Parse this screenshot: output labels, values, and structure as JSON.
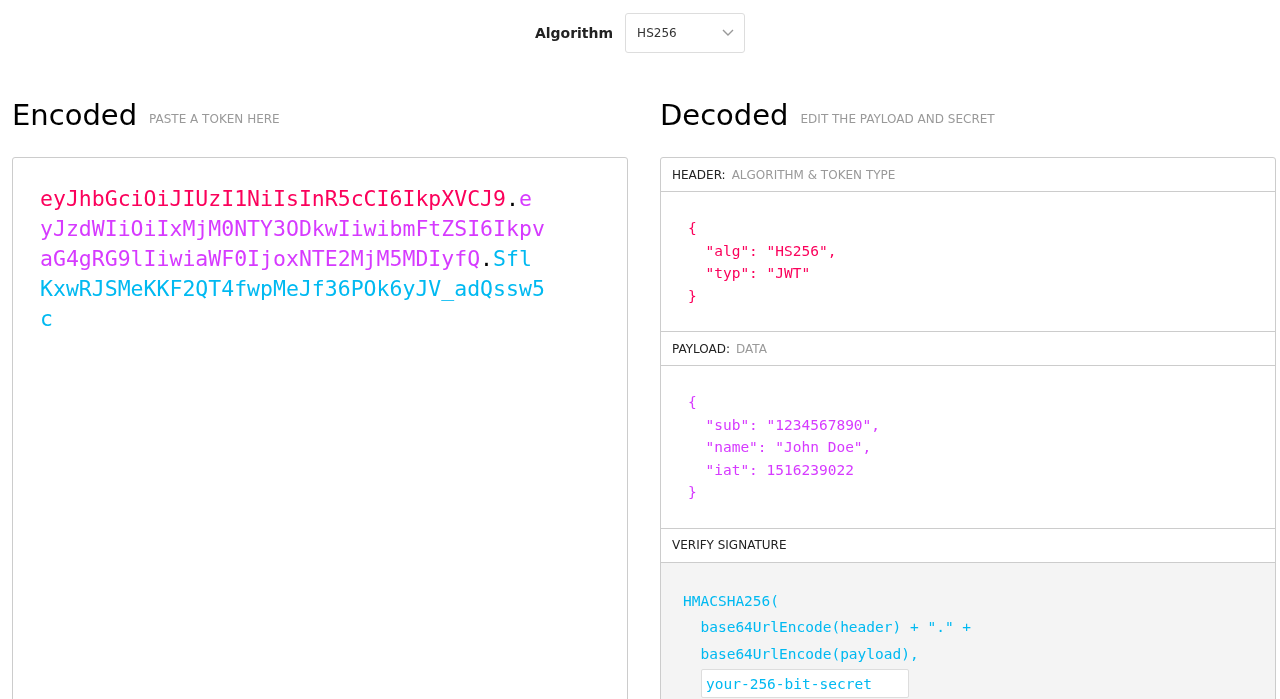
{
  "algorithm": {
    "label": "Algorithm",
    "value": "HS256"
  },
  "encoded": {
    "title": "Encoded",
    "subtitle": "PASTE A TOKEN HERE",
    "token": [
      {
        "text": "eyJhbGciOiJIUzI1NiIsInR5cCI6IkpXVCJ9",
        "color": "#fb015b"
      },
      {
        "text": ".",
        "color": "#000000"
      },
      {
        "text": "eyJzdWIiOiIxMjM0NTY3ODkwIiwibmFtZSI6IkpvaG4gRG9lIiwiaWF0IjoxNTE2MjM5MDIyfQ",
        "color": "#d63aff"
      },
      {
        "text": ".",
        "color": "#000000"
      },
      {
        "text": "SflKxwRJSMeKKF2QT4fwpMeJf36POk6yJV_adQssw5c",
        "color": "#00b9f1"
      }
    ]
  },
  "decoded": {
    "title": "Decoded",
    "subtitle": "EDIT THE PAYLOAD AND SECRET",
    "sections": [
      {
        "kind": "json",
        "label": "HEADER:",
        "sublabel": "ALGORITHM & TOKEN TYPE",
        "color": "#fb015b",
        "lines": [
          "{",
          "  \"alg\": \"HS256\",",
          "  \"typ\": \"JWT\"",
          "}"
        ]
      },
      {
        "kind": "json",
        "label": "PAYLOAD:",
        "sublabel": "DATA",
        "color": "#d63aff",
        "lines": [
          "{",
          "  \"sub\": \"1234567890\",",
          "  \"name\": \"John Doe\",",
          "  \"iat\": 1516239022",
          "}"
        ]
      },
      {
        "kind": "signature",
        "label": "VERIFY SIGNATURE",
        "color": "#00b9f1",
        "lines": [
          "HMACSHA256(",
          "  base64UrlEncode(header) + \".\" +",
          "  base64UrlEncode(payload),"
        ],
        "secret": "your-256-bit-secret"
      }
    ]
  }
}
